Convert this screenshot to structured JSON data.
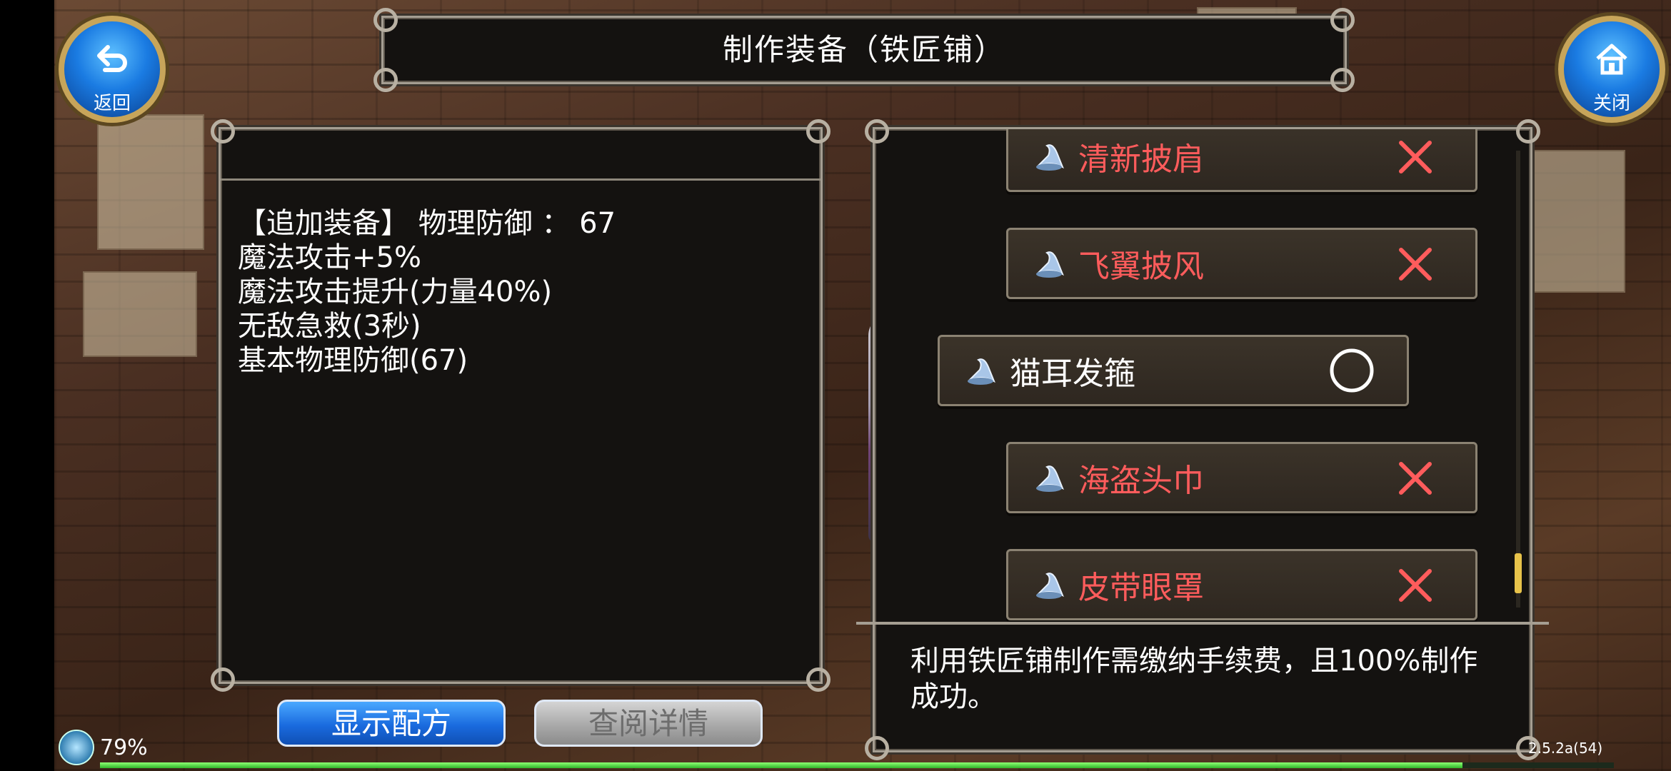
{
  "window": {
    "title": "制作装备（铁匠铺）"
  },
  "nav": {
    "back_label": "返回",
    "close_label": "关闭"
  },
  "details": {
    "lines": [
      "【追加装备】 物理防御 ：  67",
      "魔法攻击+5%",
      "魔法攻击提升(力量40%)",
      "无敌急救(3秒)",
      "基本物理防御(67)"
    ]
  },
  "recipes": {
    "items": [
      {
        "name": "清新披肩",
        "status": "unavailable",
        "icon": "wizard-hat-icon",
        "mark": "x-mark-icon"
      },
      {
        "name": "飞翼披风",
        "status": "unavailable",
        "icon": "wizard-hat-icon",
        "mark": "x-mark-icon"
      },
      {
        "name": "猫耳发箍",
        "status": "available",
        "icon": "wizard-hat-icon",
        "mark": "circle-mark-icon",
        "selected": true
      },
      {
        "name": "海盗头巾",
        "status": "unavailable",
        "icon": "wizard-hat-icon",
        "mark": "x-mark-icon"
      },
      {
        "name": "皮带眼罩",
        "status": "unavailable",
        "icon": "wizard-hat-icon",
        "mark": "x-mark-icon"
      }
    ],
    "description": "利用铁匠铺制作需缴纳手续费，且100%制作成功。"
  },
  "actions": {
    "show_recipe": "显示配方",
    "view_details": "查阅详情"
  },
  "status": {
    "battery": "79%",
    "version": "2.5.2a(54)",
    "exp_fill": 0.9
  },
  "colors": {
    "locked": "#ff5c5c",
    "accent_blue": "#1a6bdf",
    "frame": "#a59e92"
  }
}
